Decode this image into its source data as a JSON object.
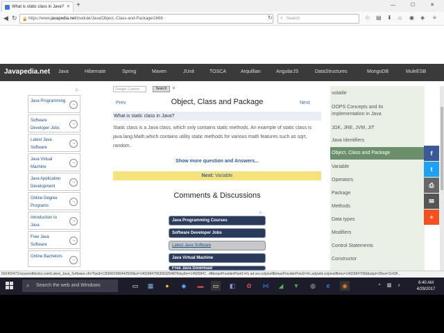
{
  "browser": {
    "tab_title": "What is static class in Java?",
    "new_tab": "+",
    "window_controls": "— ☐ ✕",
    "url_prefix": "https://www.",
    "url_domain": "javapedia.net",
    "url_path": "/module/Java/Object,-Class-and-Package/1666",
    "search_placeholder": "Search"
  },
  "site": {
    "logo": "Javapedia.net",
    "nav": [
      "Java",
      "Hibernate",
      "Spring",
      "Maven",
      "JUnit",
      "TOSCA",
      "Arquillian",
      "AngularJS",
      "DataStructures",
      "MongoDB",
      "MuleESB"
    ]
  },
  "left_ads": [
    "Java Programming",
    "Software Developer Jobs",
    "Latest Java Software",
    "Java Virtual Machine",
    "Java Application Development",
    "Online Degree Programs",
    "Introduction to Java",
    "Free Java Software",
    "Online Bachelors"
  ],
  "adchoices": "▷",
  "google_search": {
    "placeholder": "Custom",
    "prefix": "Google",
    "button": "Search",
    "clear": "✕"
  },
  "main": {
    "prev": "Prev",
    "next": "Next",
    "title": "Object, Class and Package",
    "question": "What is static class in Java?",
    "answer": "Static class is a Java class, which only contains static methods. An example of static class is java.lang.Math,which contains utility static methods for various math features such as sqrt, random.",
    "show_more": "Show more question and Answers...",
    "next_label": "Next:",
    "next_topic": "Variable",
    "comments": "Comments & Discussions"
  },
  "bottom_ads": [
    "Java Programming Courses",
    "Software Developer Jobs",
    "Latest Java Software",
    "Java Virtual Machine",
    "Free Java Download"
  ],
  "sidebar": [
    "volatile",
    "OOPS Concepts and its implementation in Java",
    "JDK, JRE, JVM, JIT",
    "Java Identifiers",
    "Object, Class and Package",
    "Variable",
    "Operators",
    "Package",
    "Methods",
    "Data types",
    "Modifiers",
    "Control Statements",
    "Constructor"
  ],
  "sidebar_active_index": 4,
  "share": [
    {
      "icon": "f",
      "color": "#3b5998"
    },
    {
      "icon": "t",
      "color": "#1da1f2"
    },
    {
      "icon": "⎙",
      "color": "#666666"
    },
    {
      "icon": "✉",
      "color": "#555555"
    },
    {
      "icon": "+",
      "color": "#f4511e"
    }
  ],
  "status_text": "692402473.keywordblocks.com/Latest_Java_Software.cfm?bsid=1356662966442509&vi=14926847953963294878dsyltm=14926847...48bmaxProviderPixel1=//c.ad-srv.co/pixel8bmaxProviderPixel2=//c.adyield.co/pixel8bms=14926847968&ubpl=28osi=11428...",
  "taskbar": {
    "search_text": "Search the web and Windows",
    "time": "6:40 AM",
    "date": "4/29/2017"
  }
}
